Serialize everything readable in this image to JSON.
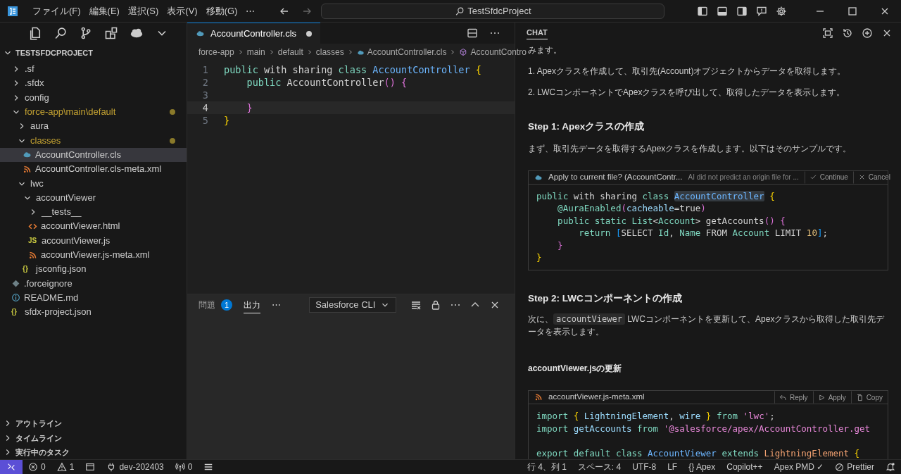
{
  "menu": [
    "ファイル(F)",
    "編集(E)",
    "選択(S)",
    "表示(V)",
    "移動(G)",
    "⋯"
  ],
  "search": {
    "value": "TestSfdcProject"
  },
  "explorer": {
    "title": "TESTSFDCPROJECT",
    "items": [
      {
        "label": ".sf",
        "kind": "folder",
        "expanded": false,
        "selected": false,
        "modified": false
      },
      {
        "label": ".sfdx",
        "kind": "folder",
        "expanded": false,
        "selected": false,
        "modified": false
      },
      {
        "label": "config",
        "kind": "folder",
        "expanded": false,
        "selected": false,
        "modified": false
      },
      {
        "label": "force-app\\main\\default",
        "kind": "folder",
        "expanded": true,
        "selected": false,
        "modified": true,
        "children": [
          {
            "label": "aura",
            "kind": "folder",
            "expanded": false,
            "selected": false,
            "modified": false
          },
          {
            "label": "classes",
            "kind": "folder",
            "expanded": true,
            "selected": false,
            "modified": true,
            "children": [
              {
                "label": "AccountController.cls",
                "kind": "apex",
                "selected": true,
                "modified": false
              },
              {
                "label": "AccountController.cls-meta.xml",
                "kind": "xml",
                "selected": false,
                "modified": false
              }
            ]
          },
          {
            "label": "lwc",
            "kind": "folder",
            "expanded": true,
            "selected": false,
            "modified": false,
            "children": [
              {
                "label": "accountViewer",
                "kind": "folder",
                "expanded": true,
                "selected": false,
                "modified": false,
                "children": [
                  {
                    "label": "__tests__",
                    "kind": "folder",
                    "expanded": false,
                    "selected": false,
                    "modified": false
                  },
                  {
                    "label": "accountViewer.html",
                    "kind": "html",
                    "selected": false,
                    "modified": false
                  },
                  {
                    "label": "accountViewer.js",
                    "kind": "glyph",
                    "glyph": "JS",
                    "selected": false,
                    "modified": false
                  },
                  {
                    "label": "accountViewer.js-meta.xml",
                    "kind": "xml",
                    "selected": false,
                    "modified": false
                  }
                ]
              },
              {
                "label": "jsconfig.json",
                "kind": "glyph",
                "glyph": "{}",
                "selected": false,
                "modified": false
              }
            ]
          }
        ]
      },
      {
        "label": ".forceignore",
        "kind": "ignore",
        "selected": false,
        "modified": false
      },
      {
        "label": "README.md",
        "kind": "info",
        "selected": false,
        "modified": false
      },
      {
        "label": "sfdx-project.json",
        "kind": "glyph",
        "glyph": "{}",
        "selected": false,
        "modified": false
      }
    ],
    "sections": [
      "アウトライン",
      "タイムライン",
      "実行中のタスク"
    ]
  },
  "editor": {
    "tab": {
      "label": "AccountController.cls",
      "modified": true
    },
    "breadcrumb": [
      {
        "label": "force-app",
        "kind": "folder"
      },
      {
        "label": "main",
        "kind": "folder"
      },
      {
        "label": "default",
        "kind": "folder"
      },
      {
        "label": "classes",
        "kind": "folder"
      },
      {
        "label": "AccountController.cls",
        "kind": "apex"
      },
      {
        "label": "AccountContro",
        "kind": "class"
      }
    ],
    "lines": [
      {
        "number": "1",
        "current": false,
        "tokens": [
          {
            "kind": "kw",
            "text": "public"
          },
          {
            "kind": "p",
            "text": " with sharing"
          },
          {
            "kind": "kw",
            "text": " class"
          },
          {
            "kind": "cls",
            "text": " AccountController"
          },
          {
            "kind": "b1",
            "text": " {"
          }
        ]
      },
      {
        "number": "2",
        "current": false,
        "tokens": [
          {
            "kind": "kw",
            "text": "    public"
          },
          {
            "kind": "p",
            "text": " AccountController"
          },
          {
            "kind": "b2",
            "text": "() {"
          }
        ]
      },
      {
        "number": "3",
        "current": false
      },
      {
        "number": "4",
        "current": true,
        "tokens": [
          {
            "kind": "b2",
            "text": "    }"
          }
        ]
      },
      {
        "number": "5",
        "current": false,
        "tokens": [
          {
            "kind": "b1",
            "text": "}"
          }
        ]
      }
    ]
  },
  "panel": {
    "tabs": [
      {
        "label": "問題",
        "badge": "1",
        "selected": false
      },
      {
        "label": "出力",
        "selected": true
      }
    ],
    "more": "⋯",
    "channel": "Salesforce CLI"
  },
  "chat": {
    "title": "CHAT",
    "blocks": [
      {
        "kind": "p",
        "text": "みます。"
      },
      {
        "kind": "p",
        "text": "1. Apexクラスを作成して、取引先(Account)オブジェクトからデータを取得します。"
      },
      {
        "kind": "p",
        "text": "2. LWCコンポーネントでApexクラスを呼び出して、取得したデータを表示します。"
      },
      {
        "kind": "h",
        "text": "Step 1: Apexクラスの作成"
      },
      {
        "kind": "p",
        "text": "まず、取引先データを取得するApexクラスを作成します。以下はそのサンプルです。"
      },
      {
        "kind": "code",
        "header": {
          "kind": "apply",
          "file": "Apply to current file? (AccountContr...",
          "note": "AI did not predict an origin file for ...",
          "actions": [
            {
              "kind": "check",
              "label": "Continue"
            },
            {
              "kind": "close",
              "label": "Cancel"
            }
          ]
        },
        "lines": [
          {
            "kind": "code",
            "tokens": [
              {
                "kind": "kw",
                "text": "public"
              },
              {
                "kind": "p",
                "text": " with sharing"
              },
              {
                "kind": "kw",
                "text": " class "
              },
              {
                "kind": "cls",
                "text": "AccountController",
                "highlighted": true
              },
              {
                "kind": "b1",
                "text": " {"
              }
            ]
          },
          {
            "kind": "code",
            "tokens": [
              {
                "kind": "kw",
                "text": "    @AuraEnabled"
              },
              {
                "kind": "b2",
                "text": "("
              },
              {
                "kind": "var",
                "text": "cacheable"
              },
              {
                "kind": "p",
                "text": "=true"
              },
              {
                "kind": "b2",
                "text": ")"
              }
            ]
          },
          {
            "kind": "code",
            "tokens": [
              {
                "kind": "kw",
                "text": "    public static List"
              },
              {
                "kind": "p",
                "text": "<"
              },
              {
                "kind": "kw",
                "text": "Account"
              },
              {
                "kind": "p",
                "text": "> getAccounts"
              },
              {
                "kind": "b2",
                "text": "() {"
              }
            ]
          },
          {
            "kind": "code",
            "tokens": [
              {
                "kind": "kw",
                "text": "        return"
              },
              {
                "kind": "b3",
                "text": " ["
              },
              {
                "kind": "p",
                "text": "SELECT"
              },
              {
                "kind": "kw",
                "text": " Id"
              },
              {
                "kind": "p",
                "text": ","
              },
              {
                "kind": "kw",
                "text": " Name"
              },
              {
                "kind": "p",
                "text": " FROM"
              },
              {
                "kind": "kw",
                "text": " Account"
              },
              {
                "kind": "p",
                "text": " LIMIT"
              },
              {
                "kind": "num",
                "text": " 10"
              },
              {
                "kind": "b3",
                "text": "]"
              },
              {
                "kind": "p",
                "text": ";"
              }
            ]
          },
          {
            "kind": "code",
            "tokens": [
              {
                "kind": "b2",
                "text": "    }"
              }
            ]
          },
          {
            "kind": "code",
            "tokens": [
              {
                "kind": "b1",
                "text": "}"
              }
            ]
          }
        ]
      },
      {
        "kind": "h",
        "text": "Step 2: LWCコンポーネントの作成"
      },
      {
        "kind": "rich",
        "parts": [
          {
            "kind": "text",
            "text": "次に、"
          },
          {
            "kind": "code",
            "text": "accountViewer"
          },
          {
            "kind": "text",
            "text": " LWCコンポーネントを更新して、Apexクラスから取得した取引先データを表示します。"
          }
        ]
      },
      {
        "kind": "h4",
        "text": "accountViewer.jsの更新"
      },
      {
        "kind": "code",
        "header": {
          "kind": "file",
          "file": "accountViewer.js-meta.xml",
          "actions": [
            {
              "kind": "reply",
              "label": "Reply"
            },
            {
              "kind": "play",
              "label": "Apply"
            },
            {
              "kind": "copy",
              "label": "Copy"
            }
          ]
        },
        "lines": [
          {
            "kind": "code",
            "tokens": [
              {
                "kind": "kw",
                "text": "import"
              },
              {
                "kind": "b1",
                "text": " {"
              },
              {
                "kind": "var",
                "text": " LightningElement"
              },
              {
                "kind": "p",
                "text": ","
              },
              {
                "kind": "var",
                "text": " wire"
              },
              {
                "kind": "b1",
                "text": " }"
              },
              {
                "kind": "kw",
                "text": " from"
              },
              {
                "kind": "str",
                "text": " 'lwc'"
              },
              {
                "kind": "p",
                "text": ";"
              }
            ]
          },
          {
            "kind": "code",
            "tokens": [
              {
                "kind": "kw",
                "text": "import"
              },
              {
                "kind": "var",
                "text": " getAccounts"
              },
              {
                "kind": "kw",
                "text": " from"
              },
              {
                "kind": "str",
                "text": " '@salesforce/apex/AccountController.get"
              }
            ]
          },
          {
            "kind": "blank"
          },
          {
            "kind": "code",
            "tokens": [
              {
                "kind": "kw",
                "text": "export default class"
              },
              {
                "kind": "cls",
                "text": " AccountViewer"
              },
              {
                "kind": "kw",
                "text": " extends"
              },
              {
                "kind": "ext",
                "text": " LightningElement"
              },
              {
                "kind": "b1",
                "text": " {"
              }
            ]
          }
        ]
      }
    ]
  },
  "status": {
    "left": [
      {
        "kind": "error",
        "text": "0"
      },
      {
        "kind": "warning",
        "text": "1"
      },
      {
        "kind": "layout"
      },
      {
        "kind": "plug",
        "text": "dev-202403"
      },
      {
        "kind": "antenna",
        "text": "0"
      },
      {
        "kind": "list"
      }
    ],
    "right": [
      "行 4、列 1",
      "スペース: 4",
      "UTF-8",
      "LF",
      "{} Apex",
      "Copilot++",
      "Apex PMD ✓",
      "Prettier"
    ]
  }
}
